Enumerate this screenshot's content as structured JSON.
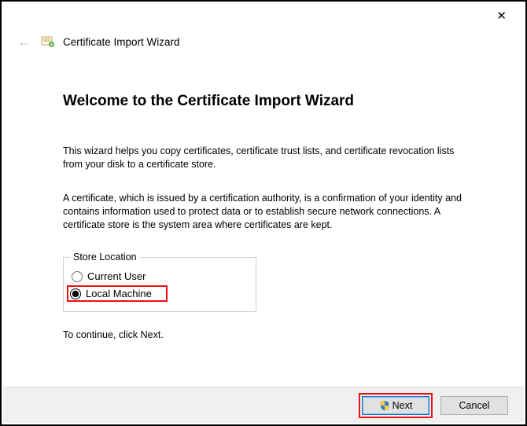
{
  "window": {
    "close_symbol": "✕",
    "back_symbol": "←",
    "wizard_title": "Certificate Import Wizard"
  },
  "page": {
    "heading": "Welcome to the Certificate Import Wizard",
    "intro": "This wizard helps you copy certificates, certificate trust lists, and certificate revocation lists from your disk to a certificate store.",
    "cert_info": "A certificate, which is issued by a certification authority, is a confirmation of your identity and contains information used to protect data or to establish secure network connections. A certificate store is the system area where certificates are kept.",
    "store_location": {
      "legend": "Store Location",
      "current_user": "Current User",
      "local_machine": "Local Machine",
      "selected": "local_machine"
    },
    "continue_hint": "To continue, click Next."
  },
  "buttons": {
    "next": "Next",
    "cancel": "Cancel"
  }
}
